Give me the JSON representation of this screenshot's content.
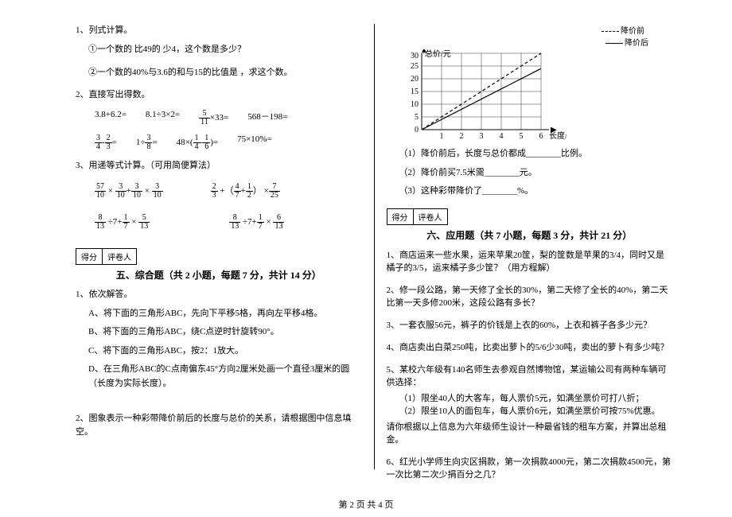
{
  "left": {
    "q1": {
      "title": "1、列式计算。",
      "a": "①一个数的 比49的 少4，这个数是多少？",
      "b": "②一个数的40%与3.6的和与15的比值是 ，求这个数。"
    },
    "q2": {
      "title": "2、直接写出得数。",
      "row1": [
        "3.8+6.2=",
        "8.1÷3×2=",
        {
          "frac": [
            5,
            11
          ],
          "after": "×33="
        },
        "568－198="
      ],
      "row2": [
        {
          "fracsub": [
            [
              3,
              4
            ],
            [
              2,
              3
            ]
          ],
          "after": "="
        },
        {
          "oneplus": [
            3,
            8
          ],
          "after": "="
        },
        {
          "forty": [
            [
              1,
              4
            ],
            [
              1,
              6
            ]
          ],
          "pre": "48×(",
          "mid": "-",
          "after": ")="
        },
        "75×10%="
      ]
    },
    "q3": {
      "title": "3、用递等式计算。（可用简便算法）",
      "r1a": {
        "terms": [
          [
            57,
            10
          ],
          [
            3,
            10
          ],
          [
            3,
            10
          ]
        ],
        "ops": [
          "×",
          "+",
          "×"
        ]
      },
      "r1b": {
        "terms": [
          [
            2,
            3
          ],
          [
            4,
            7
          ],
          [
            1,
            2
          ],
          [
            7,
            25
          ]
        ]
      },
      "r2a": {
        "terms": [
          [
            8,
            13
          ],
          [
            1,
            7
          ],
          [
            5,
            13
          ]
        ]
      },
      "r2b": {
        "terms": [
          [
            8,
            13
          ],
          [
            1,
            7
          ],
          [
            6,
            13
          ]
        ]
      }
    },
    "score": {
      "a": "得分",
      "b": "评卷人"
    },
    "sec5": {
      "title": "五、综合题（共 2 小题，每题 7 分，共计 14 分）",
      "q1": "1、依次解答。",
      "a": "A、将下面的三角形ABC，先向下平移5格，再向左平移4格。",
      "b": "B、将下面的三角形ABC，绕C点逆时针旋转90°。",
      "c": "C、将下面的三角形ABC，按2：1放大。",
      "d": "D、在三角形ABC的C点南偏东45°方向2厘米处画一个直径3厘米的圆（长度为实际长度）。",
      "q2": "2、图象表示一种彩带降价前后的长度与总价的关系，请根据图中信息填空。"
    }
  },
  "right": {
    "legend": {
      "a": "降价前",
      "b": "降价后"
    },
    "axis": {
      "y": "总价/元",
      "x": "长度/米"
    },
    "sub1": "（1）降价前后，长度与总价都成________比例。",
    "sub2": "（2）降价前买7.5米需________元。",
    "sub3": "（3）这种彩带降价了________%。",
    "score": {
      "a": "得分",
      "b": "评卷人"
    },
    "sec6": {
      "title": "六、应用题（共 7 小题，每题 3 分，共计 21 分）",
      "q1": "1、商店运来一些水果，运来苹果20筐，梨的筐数是苹果的3/4，同时又是橘子的3/5，运来橘子多少筐？（用方程解）",
      "q2": "2、修一段公路，第一天修了全长的30%，第二天修了全长的40%，第二天比第一天多修200米，这段公路有多长？",
      "q3": "3、一套衣服56元，裤子的价钱是上衣的60%，上衣和裤子各多少元？",
      "q4": "4、商店卖出白菜250吨，比卖出萝卜的5/6少30吨，卖出的萝卜有多少吨？",
      "q5": "5、某校六年级有140名师生去参观自然博物馆，某运输公司有两种车辆可供选择：",
      "q5a": "（1）限坐40人的大客车，每人票价5元，如满坐票价可打八折；",
      "q5b": "（2）限坐10人的面包车，每人票价6元，如满坐票价可按75%优惠。",
      "q5c": "请你根据以上信息为六年级师生设计一种最省钱的租车方案，并算出总租金。",
      "q6": "6、红光小学师生向灾区捐款，第一次捐款4000元，第二次捐款4500元，第一次比第二次少捐百分之几？"
    }
  },
  "chart_data": {
    "type": "line",
    "title": "",
    "xlabel": "长度/米",
    "ylabel": "总价/元",
    "xlim": [
      0,
      7
    ],
    "ylim": [
      0,
      30
    ],
    "x": [
      0,
      1,
      2,
      3,
      4,
      5,
      6
    ],
    "series": [
      {
        "name": "降价前",
        "style": "dashed",
        "values": [
          0,
          5,
          10,
          15,
          20,
          25,
          30
        ]
      },
      {
        "name": "降价后",
        "style": "solid",
        "values": [
          0,
          4,
          8,
          12,
          16,
          20,
          24
        ]
      }
    ],
    "yticks": [
      0,
      5,
      10,
      15,
      20,
      25,
      30
    ]
  },
  "footer": "第 2 页 共 4 页"
}
